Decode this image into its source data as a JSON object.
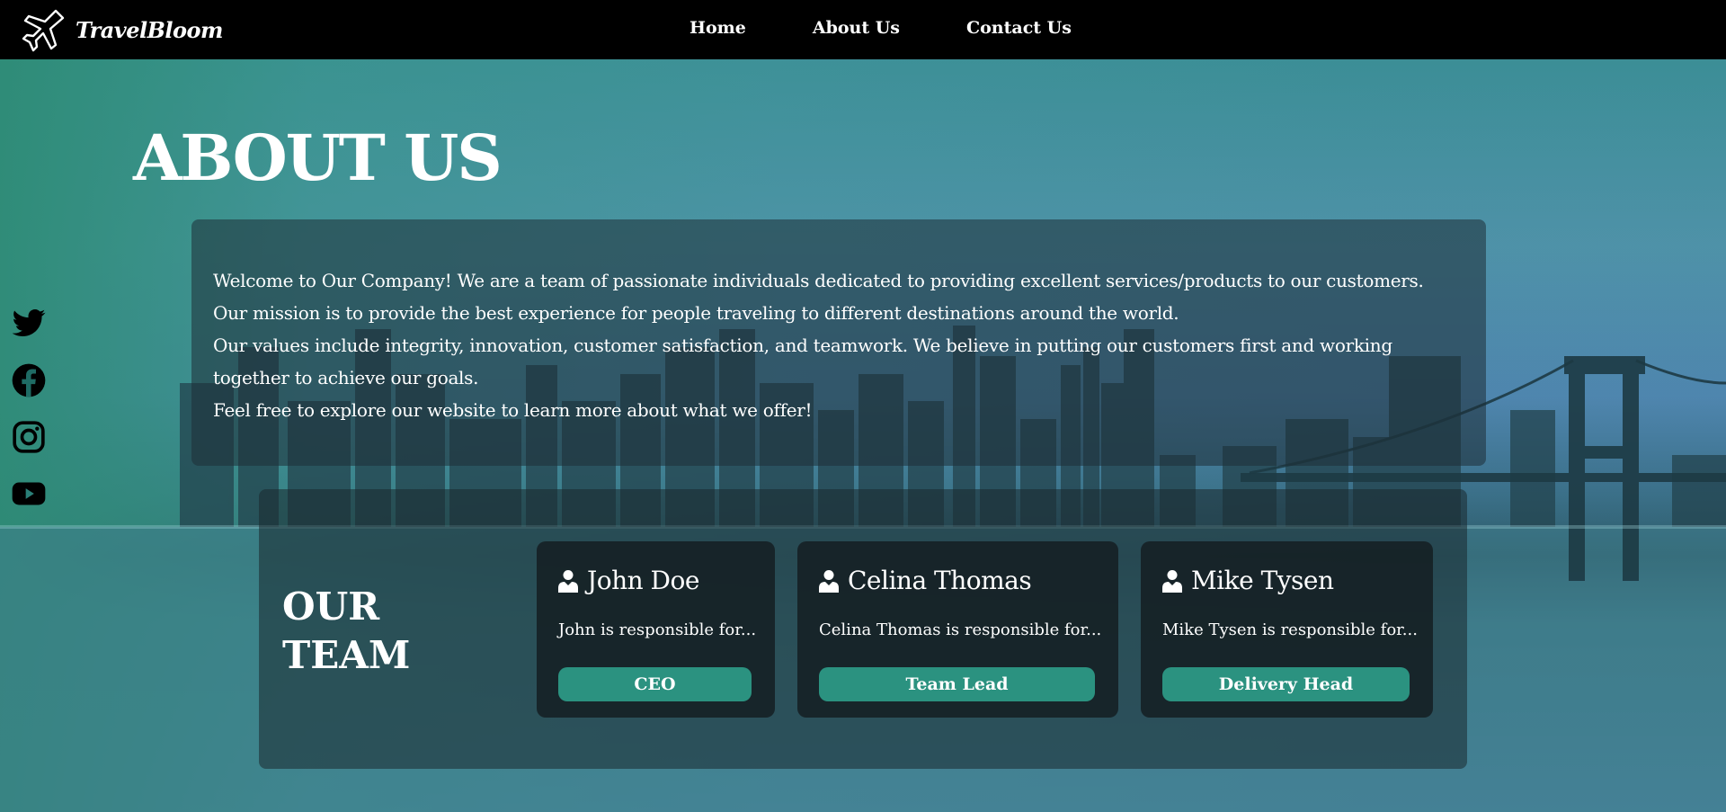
{
  "brand": {
    "name": "TravelBloom",
    "icon": "airplane-icon"
  },
  "nav": {
    "items": [
      "Home",
      "About Us",
      "Contact Us"
    ]
  },
  "social": [
    "twitter-icon",
    "facebook-icon",
    "instagram-icon",
    "youtube-icon"
  ],
  "page_title": "ABOUT US",
  "about": {
    "paragraphs": [
      "Welcome to Our Company! We are a team of passionate individuals dedicated to providing excellent services/products to our customers.",
      "Our mission is to provide the best experience for people traveling to different destinations around the world.",
      "Our values include integrity, innovation, customer satisfaction, and teamwork. We believe in putting our customers first and working together to achieve our goals.",
      "Feel free to explore our website to learn more about what we offer!"
    ]
  },
  "team": {
    "title_line1": "OUR",
    "title_line2": "TEAM",
    "members": [
      {
        "name": "John Doe",
        "desc": "John is responsible for...",
        "role": "CEO"
      },
      {
        "name": "Celina Thomas",
        "desc": "Celina Thomas is responsible for...",
        "role": "Team Lead"
      },
      {
        "name": "Mike Tysen",
        "desc": "Mike Tysen is responsible for...",
        "role": "Delivery Head"
      }
    ]
  },
  "colors": {
    "accent": "#2b9280",
    "navbar": "#000000"
  }
}
